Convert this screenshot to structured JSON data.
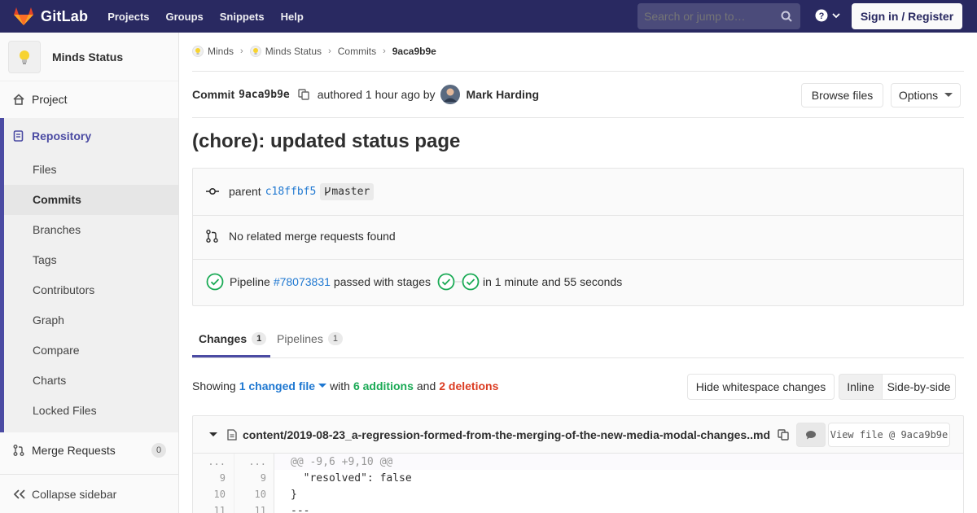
{
  "navbar": {
    "brand": "GitLab",
    "links": [
      "Projects",
      "Groups",
      "Snippets",
      "Help"
    ],
    "search_placeholder": "Search or jump to…",
    "signin_label": "Sign in / Register",
    "colors": {
      "bg": "#292961",
      "logo_orange": "#e24329"
    }
  },
  "sidebar": {
    "project_name": "Minds Status",
    "project_label": "Project",
    "repository_label": "Repository",
    "repo_items": [
      "Files",
      "Commits",
      "Branches",
      "Tags",
      "Contributors",
      "Graph",
      "Compare",
      "Charts",
      "Locked Files"
    ],
    "active_item": "Commits",
    "merge_requests_label": "Merge Requests",
    "merge_requests_count": "0",
    "collapse_label": "Collapse sidebar",
    "accent": "#4b4ba3"
  },
  "breadcrumb": {
    "items": [
      "Minds",
      "Minds Status",
      "Commits"
    ],
    "current": "9aca9b9e"
  },
  "commit": {
    "label": "Commit",
    "sha": "9aca9b9e",
    "authored_text": "authored 1 hour ago by",
    "author": "Mark Harding",
    "browse_files": "Browse files",
    "options": "Options",
    "title": "(chore): updated status page"
  },
  "info": {
    "parent_label": "parent",
    "parent_sha": "c18ffbf5",
    "branch": "master",
    "mr_text": "No related merge requests found",
    "pipeline_label": "Pipeline",
    "pipeline_id": "#78073831",
    "pipeline_status": "passed with stages",
    "pipeline_duration": "in 1 minute and 55 seconds"
  },
  "tabs": [
    {
      "label": "Changes",
      "count": "1"
    },
    {
      "label": "Pipelines",
      "count": "1"
    }
  ],
  "changes": {
    "showing": "Showing",
    "changed_files": "1 changed file",
    "with": "with",
    "additions": "6 additions",
    "and": "and",
    "deletions": "2 deletions",
    "hide_whitespace": "Hide whitespace changes",
    "inline": "Inline",
    "side_by_side": "Side-by-side"
  },
  "file": {
    "path": "content/2019-08-23_a-regression-formed-from-the-merging-of-the-new-media-modal-changes..md",
    "view_file": "View file @ 9aca9b9e"
  },
  "diff": {
    "lines": [
      {
        "old": "...",
        "new": "...",
        "code": "@@ -9,6 +9,10 @@",
        "hunk": true
      },
      {
        "old": "9",
        "new": "9",
        "code": "  \"resolved\": false"
      },
      {
        "old": "10",
        "new": "10",
        "code": "}"
      },
      {
        "old": "11",
        "new": "11",
        "code": "---"
      }
    ]
  }
}
